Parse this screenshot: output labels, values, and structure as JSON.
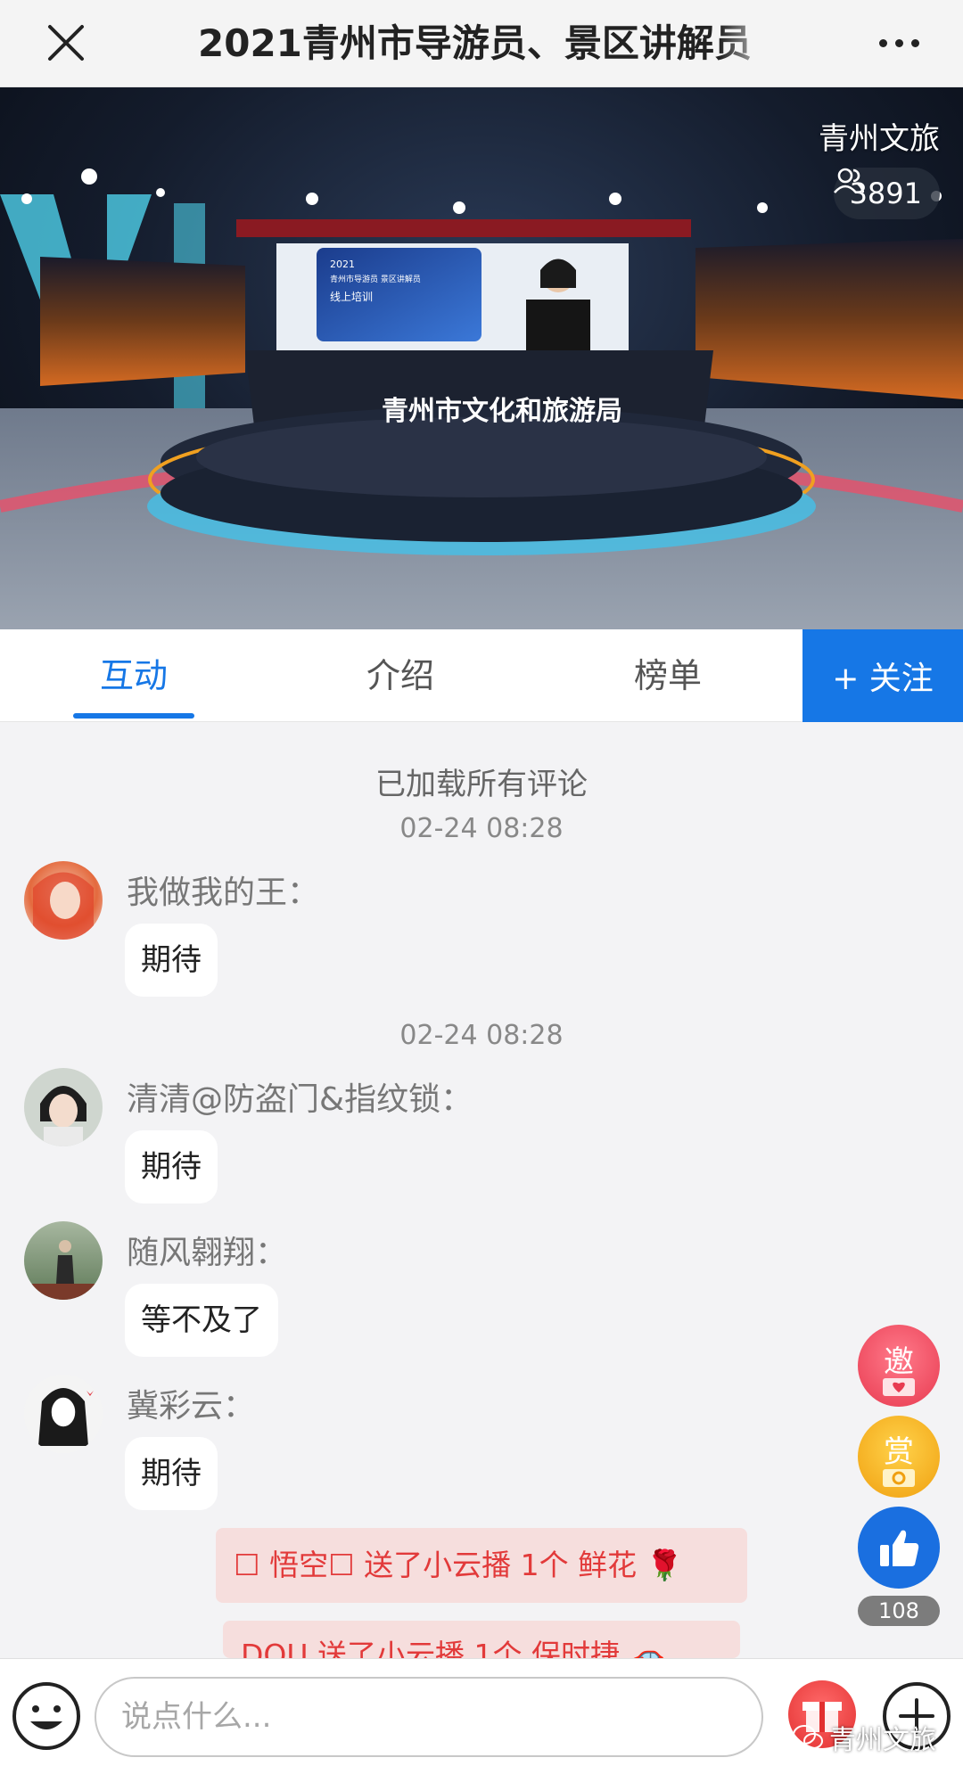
{
  "header": {
    "title": "2021青州市导游员、景区讲解员"
  },
  "video": {
    "channel_name": "青州文旅",
    "viewer_count": "3891",
    "desk_sign": "青州市文化和旅游局",
    "screen_year": "2021",
    "screen_line1": "青州市导游员 景区讲解员",
    "screen_line2": "线上培训"
  },
  "tabs": {
    "interact": "互动",
    "intro": "介绍",
    "rank": "榜单",
    "follow": "+ 关注"
  },
  "comments": {
    "loaded_notice": "已加载所有评论",
    "items": [
      {
        "timestamp": "02-24 08:28",
        "user": "我做我的王：",
        "text": "期待"
      },
      {
        "timestamp": "02-24 08:28",
        "user": "清清@防盗门&指纹锁：",
        "text": "期待"
      },
      {
        "user": "随风翱翔：",
        "text": "等不及了"
      },
      {
        "user": "冀彩云：",
        "text": "期待"
      }
    ],
    "gifts": [
      {
        "text": "☐ 悟空☐  送了小云播 1个 鲜花 🌹"
      },
      {
        "text": "DOU   送了小云播 1个 保时捷 🚗"
      }
    ]
  },
  "actions": {
    "invite": "邀",
    "reward": "赏",
    "like_count": "108"
  },
  "footer": {
    "input_placeholder": "说点什么...",
    "watermark": "青州文旅"
  },
  "colors": {
    "accent": "#1677e6",
    "gift_text": "#e23a3a",
    "gift_bg": "#f6dedd"
  }
}
